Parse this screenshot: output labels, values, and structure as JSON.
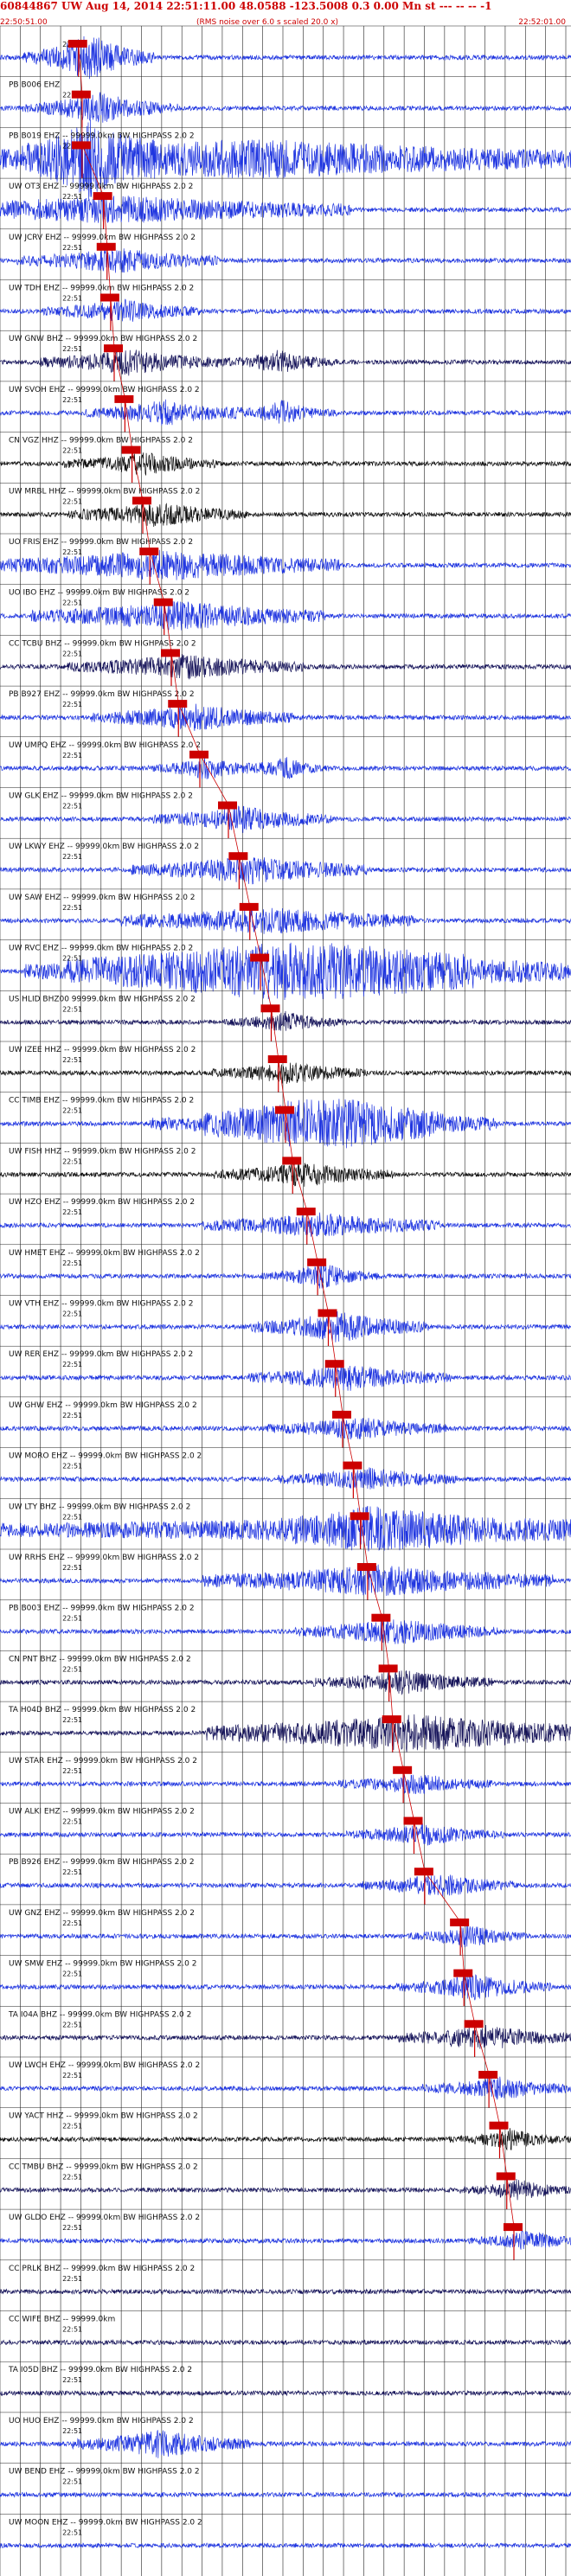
{
  "header": {
    "event_title": "60844867 UW Aug 14, 2014 22:51:11.00   48.0588 -123.5008  0.3 0.00 Mn st --- -- --  -1",
    "time_start": "22:50:51.00",
    "rms_note": "(RMS noise over 6.0 s scaled 20.0 x)",
    "time_end": "22:52:01.00"
  },
  "colors": {
    "header": "#cc0000",
    "pick": "#cc0000",
    "blue_trace": "#1f35e0",
    "black_trace": "#111111",
    "navy_trace": "#16145a",
    "grid": "#222222"
  },
  "chart_data": {
    "type": "seismogram",
    "title": "60844867 UW Aug 14, 2014 22:51:11.00   48.0588 -123.5008  0.3 0.00 Mn st --- -- --  -1",
    "x_range": [
      "22:50:51.00",
      "22:52:01.00"
    ],
    "minute_mark": "22:51",
    "grid": true,
    "traces": [
      {
        "label": "",
        "color": "blue",
        "pick": 22.0,
        "bursts": [
          [
            25,
            0.06,
            3.0
          ]
        ]
      },
      {
        "label": "PB B006 EHZ",
        "color": "blue",
        "pick": 23.0,
        "bursts": [
          [
            28,
            0.08,
            1.8
          ]
        ]
      },
      {
        "label": "PB B019 EHZ -- 99999.0km BW HIGHPASS  2.0  2",
        "color": "blue",
        "pick": 23.0,
        "bursts": [
          [
            25,
            0.06,
            3.6
          ],
          [
            70,
            0.55,
            2.4
          ]
        ]
      },
      {
        "label": "UW OT3 EHZ -- 99999.0km BW HIGHPASS  2.0  2",
        "color": "blue",
        "pick": 29.0,
        "bursts": [
          [
            33,
            0.35,
            1.6
          ]
        ]
      },
      {
        "label": "UW JCRV EHZ -- 99999.0km BW HIGHPASS  2.0  2",
        "color": "blue",
        "pick": 30.0,
        "bursts": [
          [
            33,
            0.12,
            1.4
          ]
        ]
      },
      {
        "label": "UW TDH EHZ -- 99999.0km BW HIGHPASS  2.0  2",
        "color": "blue",
        "pick": 31.0,
        "bursts": [
          [
            34,
            0.08,
            1.4
          ]
        ]
      },
      {
        "label": "UW GNW BHZ -- 99999.0km BW HIGHPASS  2.0  2",
        "color": "navy",
        "pick": 32.0,
        "bursts": [
          [
            36,
            0.1,
            1.5
          ],
          [
            78,
            0.05,
            1.4
          ]
        ]
      },
      {
        "label": "UW SVOH EHZ -- 99999.0km BW HIGHPASS  2.0  2",
        "color": "blue",
        "pick": 35.0,
        "bursts": [
          [
            46,
            0.08,
            1.5
          ],
          [
            79,
            0.04,
            1.5
          ]
        ]
      },
      {
        "label": "CN VGZ HHZ -- 99999.0km BW HIGHPASS  2.0  2",
        "color": "black",
        "pick": 37.0,
        "bursts": [
          [
            40,
            0.08,
            1.3
          ]
        ]
      },
      {
        "label": "UW MRBL HHZ -- 99999.0km BW HIGHPASS  2.0  2",
        "color": "black",
        "pick": 40.0,
        "bursts": [
          [
            44,
            0.1,
            1.4
          ]
        ]
      },
      {
        "label": "UO FRIS EHZ -- 99999.0km BW HIGHPASS  2.0  2",
        "color": "blue",
        "pick": 42.0,
        "bursts": [
          [
            46,
            0.25,
            1.8
          ]
        ]
      },
      {
        "label": "UO IBO EHZ -- 99999.0km BW HIGHPASS  2.0  2",
        "color": "blue",
        "pick": 46.0,
        "bursts": [
          [
            50,
            0.2,
            1.7
          ]
        ]
      },
      {
        "label": "CC TCBU BHZ -- 99999.0km BW HIGHPASS  2.0  2",
        "color": "navy",
        "pick": 48.0,
        "bursts": [
          [
            52,
            0.15,
            1.4
          ]
        ]
      },
      {
        "label": "PB B927 EHZ -- 99999.0km BW HIGHPASS  2.0  2",
        "color": "blue",
        "pick": 50.0,
        "bursts": [
          [
            54,
            0.12,
            1.6
          ]
        ]
      },
      {
        "label": "UW UMPQ EHZ -- 99999.0km BW HIGHPASS  2.0  2",
        "color": "blue",
        "pick": 56.0,
        "bursts": [
          [
            58,
            0.05,
            1.3
          ],
          [
            80,
            0.03,
            1.4
          ]
        ]
      },
      {
        "label": "UW GLK EHZ -- 99999.0km BW HIGHPASS  2.0  2",
        "color": "blue",
        "pick": 64.0,
        "bursts": [
          [
            68,
            0.1,
            1.5
          ]
        ]
      },
      {
        "label": "UW LKWY EHZ -- 99999.0km BW HIGHPASS  2.0  2",
        "color": "blue",
        "pick": 67.0,
        "bursts": [
          [
            70,
            0.15,
            1.6
          ]
        ]
      },
      {
        "label": "UW SAW EHZ -- 99999.0km BW HIGHPASS  2.0  2",
        "color": "blue",
        "pick": 70.0,
        "bursts": [
          [
            75,
            0.2,
            1.6
          ]
        ]
      },
      {
        "label": "UW RVC EHZ -- 99999.0km BW HIGHPASS  2.0  2",
        "color": "blue",
        "pick": 73.0,
        "bursts": [
          [
            76,
            0.3,
            1.9
          ],
          [
            96,
            0.5,
            2.1
          ]
        ]
      },
      {
        "label": "US HLID BHZ00 99999.0km BW HIGHPASS  2.0  2",
        "color": "navy",
        "pick": 76.0,
        "bursts": [
          [
            80,
            0.05,
            1.2
          ]
        ]
      },
      {
        "label": "UW IZEE HHZ -- 99999.0km BW HIGHPASS  2.0  2",
        "color": "black",
        "pick": 78.0,
        "bursts": [
          [
            81,
            0.08,
            1.3
          ]
        ]
      },
      {
        "label": "CC TIMB EHZ -- 99999.0km BW HIGHPASS  2.0  2",
        "color": "blue",
        "pick": 80.0,
        "bursts": [
          [
            83,
            0.2,
            1.7
          ],
          [
            98,
            0.2,
            1.9
          ]
        ]
      },
      {
        "label": "UW FISH HHZ -- 99999.0km BW HIGHPASS  2.0  2",
        "color": "black",
        "pick": 82.0,
        "bursts": [
          [
            85,
            0.1,
            1.4
          ]
        ]
      },
      {
        "label": "UW HZO EHZ -- 99999.0km BW HIGHPASS  2.0  2",
        "color": "blue",
        "pick": 86.0,
        "bursts": [
          [
            90,
            0.15,
            1.4
          ]
        ]
      },
      {
        "label": "UW HMET EHZ -- 99999.0km BW HIGHPASS  2.0  2",
        "color": "blue",
        "pick": 89.0,
        "bursts": [
          [
            90,
            0.05,
            1.5
          ]
        ]
      },
      {
        "label": "UW VTH EHZ -- 99999.0km BW HIGHPASS  2.0  2",
        "color": "blue",
        "pick": 92.0,
        "bursts": [
          [
            95,
            0.1,
            1.8
          ]
        ]
      },
      {
        "label": "UW RER EHZ -- 99999.0km BW HIGHPASS  2.0  2",
        "color": "blue",
        "pick": 94.0,
        "bursts": [
          [
            98,
            0.12,
            1.5
          ]
        ]
      },
      {
        "label": "UW GHW EHZ -- 99999.0km BW HIGHPASS  2.0  2",
        "color": "blue",
        "pick": 96.0,
        "bursts": [
          [
            100,
            0.1,
            1.3
          ]
        ]
      },
      {
        "label": "UW MORO EHZ -- 99999.0km BW HIGHPASS  2.0  2",
        "color": "blue",
        "pick": 99.0,
        "bursts": [
          [
            103,
            0.1,
            1.3
          ]
        ]
      },
      {
        "label": "UW LTY BHZ -- 99999.0km BW HIGHPASS  2.0  2",
        "color": "blue",
        "pick": 101.0,
        "bursts": [
          [
            104,
            0.1,
            1.6
          ],
          [
            120,
            0.8,
            1.5
          ]
        ]
      },
      {
        "label": "UW RRHS EHZ -- 99999.0km BW HIGHPASS  2.0  2",
        "color": "blue",
        "pick": 103.0,
        "bursts": [
          [
            106,
            0.25,
            1.8
          ]
        ]
      },
      {
        "label": "PB B003 EHZ -- 99999.0km BW HIGHPASS  2.0  2",
        "color": "blue",
        "pick": 107.0,
        "bursts": [
          [
            111,
            0.12,
            1.5
          ]
        ]
      },
      {
        "label": "CN PNT BHZ -- 99999.0km BW HIGHPASS  2.0  2",
        "color": "navy",
        "pick": 109.0,
        "bursts": [
          [
            113,
            0.1,
            1.3
          ]
        ]
      },
      {
        "label": "TA H04D BHZ -- 99999.0km BW HIGHPASS  2.0  2",
        "color": "navy",
        "pick": 110.0,
        "bursts": [
          [
            115,
            0.3,
            2.2
          ]
        ]
      },
      {
        "label": "UW STAR EHZ -- 99999.0km BW HIGHPASS  2.0  2",
        "color": "blue",
        "pick": 113.0,
        "bursts": [
          [
            116,
            0.08,
            1.2
          ]
        ]
      },
      {
        "label": "UW ALKI EHZ -- 99999.0km BW HIGHPASS  2.0  2",
        "color": "blue",
        "pick": 116.0,
        "bursts": [
          [
            119,
            0.08,
            1.2
          ]
        ]
      },
      {
        "label": "PB B926 EHZ -- 99999.0km BW HIGHPASS  2.0  2",
        "color": "blue",
        "pick": 119.0,
        "bursts": [
          [
            123,
            0.08,
            1.4
          ]
        ]
      },
      {
        "label": "UW GNZ EHZ -- 99999.0km BW HIGHPASS  2.0  2",
        "color": "blue",
        "pick": 129.0,
        "bursts": [
          [
            131,
            0.05,
            1.4
          ]
        ]
      },
      {
        "label": "UW SMW EHZ -- 99999.0km BW HIGHPASS  2.0  2",
        "color": "blue",
        "pick": 130.0,
        "bursts": [
          [
            133,
            0.08,
            1.5
          ]
        ]
      },
      {
        "label": "TA I04A BHZ -- 99999.0km BW HIGHPASS  2.0  2",
        "color": "navy",
        "pick": 133.0,
        "bursts": [
          [
            136,
            0.1,
            1.5
          ]
        ]
      },
      {
        "label": "UW LWCH EHZ -- 99999.0km BW HIGHPASS  2.0  2",
        "color": "blue",
        "pick": 137.0,
        "bursts": [
          [
            140,
            0.08,
            1.3
          ]
        ]
      },
      {
        "label": "UW YACT HHZ -- 99999.0km BW HIGHPASS  2.0  2",
        "color": "black",
        "pick": 140.0,
        "bursts": [
          [
            143,
            0.05,
            1.2
          ]
        ]
      },
      {
        "label": "CC TMBU BHZ -- 99999.0km BW HIGHPASS  2.0  2",
        "color": "navy",
        "pick": 142.0,
        "bursts": [
          [
            145,
            0.05,
            1.2
          ]
        ]
      },
      {
        "label": "UW GLDO EHZ -- 99999.0km BW HIGHPASS  2.0  2",
        "color": "blue",
        "pick": 144.0,
        "bursts": [
          [
            148,
            0.05,
            1.2
          ]
        ]
      },
      {
        "label": "CC PRLK BHZ -- 99999.0km BW HIGHPASS  2.0  2",
        "color": "navy",
        "pick": null,
        "bursts": []
      },
      {
        "label": "CC WIFE BHZ -- 99999.0km",
        "color": "navy",
        "pick": null,
        "bursts": []
      },
      {
        "label": "TA I05D BHZ -- 99999.0km BW HIGHPASS  2.0  2",
        "color": "navy",
        "pick": null,
        "bursts": []
      },
      {
        "label": "UO HUO EHZ -- 99999.0km BW HIGHPASS  2.0  2",
        "color": "blue",
        "pick": null,
        "bursts": [
          [
            45,
            0.1,
            1.6
          ]
        ]
      },
      {
        "label": "UW BEND EHZ -- 99999.0km BW HIGHPASS  2.0  2",
        "color": "blue",
        "pick": null,
        "bursts": []
      },
      {
        "label": "UW MOON EHZ -- 99999.0km BW HIGHPASS  2.0  2",
        "color": "blue",
        "pick": null,
        "bursts": []
      }
    ]
  }
}
